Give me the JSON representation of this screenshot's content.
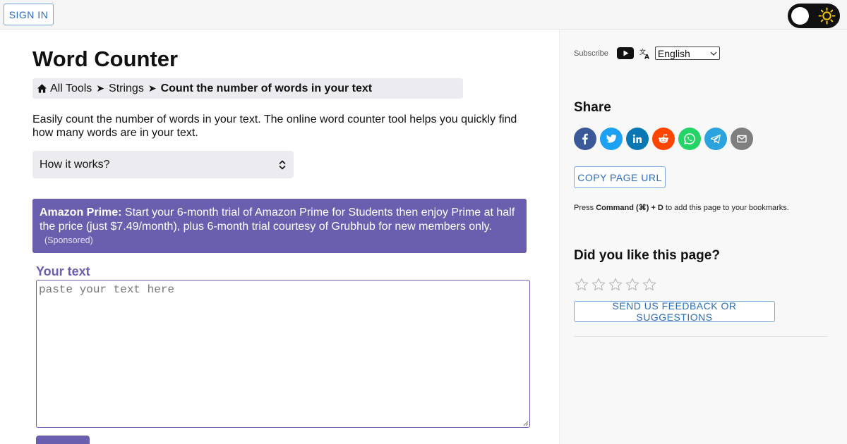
{
  "topbar": {
    "sign_in_label": "SIGN IN",
    "theme_toggle_state": "light"
  },
  "main": {
    "title": "Word Counter",
    "breadcrumb": {
      "items": [
        "All Tools",
        "Strings"
      ],
      "separator": "➤",
      "current": "Count the number of words in your text"
    },
    "intro": "Easily count the number of words in your text. The online word counter tool helps you quickly find how many words are in your text.",
    "how_it_works_label": "How it works?",
    "ad": {
      "brand": "Amazon Prime:",
      "text": "Start your 6-month trial of Amazon Prime for Students then enjoy Prime at half the price (just $7.49/month), plus 6-month trial courtesy of Grubhub for new members only.",
      "sponsored": "(Sponsored)"
    },
    "input": {
      "label": "Your text",
      "placeholder": "paste your text here",
      "value": ""
    }
  },
  "sidebar": {
    "subscribe_label": "Subscribe",
    "language": "English",
    "share_title": "Share",
    "share_buttons": [
      {
        "name": "facebook",
        "color": "#3b5998",
        "icon": "facebook-icon"
      },
      {
        "name": "twitter",
        "color": "#1da1f2",
        "icon": "twitter-icon"
      },
      {
        "name": "linkedin",
        "color": "#0a77b5",
        "icon": "linkedin-icon"
      },
      {
        "name": "reddit",
        "color": "#ff4500",
        "icon": "reddit-icon"
      },
      {
        "name": "whatsapp",
        "color": "#25d366",
        "icon": "whatsapp-icon"
      },
      {
        "name": "telegram",
        "color": "#2aa3df",
        "icon": "telegram-icon"
      },
      {
        "name": "email",
        "color": "#7f7f7f",
        "icon": "email-icon"
      }
    ],
    "copy_url_label": "COPY PAGE URL",
    "bookmark_hint": {
      "prefix": "Press",
      "keys": "Command (⌘) + D",
      "suffix": "to add this page to your bookmarks."
    },
    "like_title": "Did you like this page?",
    "rating": 0,
    "rating_max": 5,
    "feedback_label": "SEND US FEEDBACK OR SUGGESTIONS"
  },
  "colors": {
    "accent": "#6a5fae",
    "link": "#2b6cb8"
  }
}
